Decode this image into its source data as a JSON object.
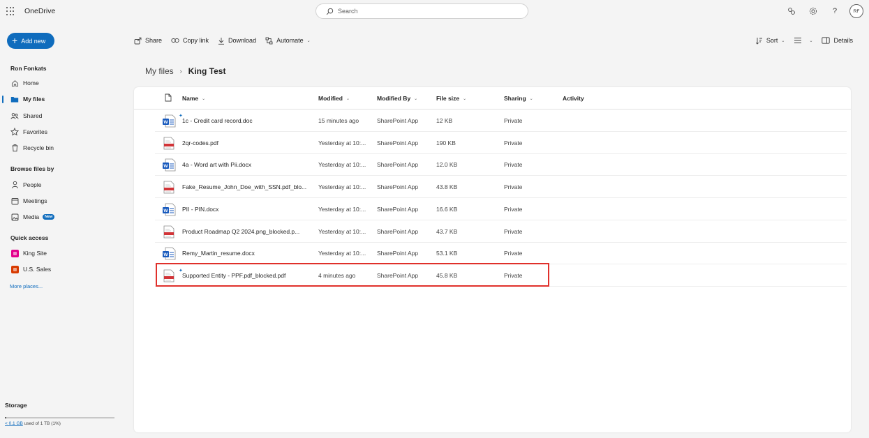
{
  "app": {
    "title": "OneDrive"
  },
  "search": {
    "placeholder": "Search"
  },
  "user": {
    "initials": "RF",
    "name": "Ron Fonkats"
  },
  "sidebar": {
    "add_new": "Add new",
    "items": [
      {
        "label": "Home",
        "icon": "home-icon"
      },
      {
        "label": "My files",
        "icon": "folder-icon",
        "active": true
      },
      {
        "label": "Shared",
        "icon": "people-icon"
      },
      {
        "label": "Favorites",
        "icon": "star-icon"
      },
      {
        "label": "Recycle bin",
        "icon": "trash-icon"
      }
    ],
    "browse_heading": "Browse files by",
    "browse": [
      {
        "label": "People",
        "icon": "person-icon"
      },
      {
        "label": "Meetings",
        "icon": "calendar-icon"
      },
      {
        "label": "Media",
        "icon": "image-icon",
        "badge": "New"
      }
    ],
    "quick_heading": "Quick access",
    "quick": [
      {
        "label": "King Site",
        "color": "#e3008c"
      },
      {
        "label": "U.S. Sales",
        "color": "#d83b01"
      }
    ],
    "more_places": "More places...",
    "storage": {
      "heading": "Storage",
      "used_link": "< 0.1 GB",
      "used_text": " used of 1 TB (1%)",
      "fraction": 0.01
    }
  },
  "commands": {
    "share": "Share",
    "copy_link": "Copy link",
    "download": "Download",
    "automate": "Automate",
    "sort": "Sort",
    "details": "Details"
  },
  "breadcrumb": {
    "parent": "My files",
    "current": "King Test"
  },
  "table": {
    "headers": {
      "name": "Name",
      "modified": "Modified",
      "modified_by": "Modified By",
      "size": "File size",
      "sharing": "Sharing",
      "activity": "Activity"
    },
    "rows": [
      {
        "type": "word",
        "name": "1c - Credit card record.doc",
        "modified": "15 minutes ago",
        "by": "SharePoint App",
        "size": "12 KB",
        "sharing": "Private",
        "new": true
      },
      {
        "type": "pdf",
        "name": "2qr-codes.pdf",
        "modified": "Yesterday at 10:...",
        "by": "SharePoint App",
        "size": "190 KB",
        "sharing": "Private",
        "new": false
      },
      {
        "type": "word",
        "name": "4a - Word art with Pii.docx",
        "modified": "Yesterday at 10:...",
        "by": "SharePoint App",
        "size": "12.0 KB",
        "sharing": "Private",
        "new": false
      },
      {
        "type": "pdf",
        "name": "Fake_Resume_John_Doe_with_SSN.pdf_blo...",
        "modified": "Yesterday at 10:...",
        "by": "SharePoint App",
        "size": "43.8 KB",
        "sharing": "Private",
        "new": false
      },
      {
        "type": "word",
        "name": "PII - PIN.docx",
        "modified": "Yesterday at 10:...",
        "by": "SharePoint App",
        "size": "16.6 KB",
        "sharing": "Private",
        "new": false
      },
      {
        "type": "pdf",
        "name": "Product Roadmap Q2 2024.png_blocked.p...",
        "modified": "Yesterday at 10:...",
        "by": "SharePoint App",
        "size": "43.7 KB",
        "sharing": "Private",
        "new": false
      },
      {
        "type": "word",
        "name": "Remy_Martin_resume.docx",
        "modified": "Yesterday at 10:...",
        "by": "SharePoint App",
        "size": "53.1 KB",
        "sharing": "Private",
        "new": false
      },
      {
        "type": "pdf",
        "name": "Supported Entity - PPF.pdf_blocked.pdf",
        "modified": "4 minutes ago",
        "by": "SharePoint App",
        "size": "45.8 KB",
        "sharing": "Private",
        "new": true,
        "highlighted": true
      }
    ]
  },
  "colors": {
    "accent": "#0f6cbd",
    "highlight": "#e0302b",
    "word": "#185abd",
    "pdf": "#d13438"
  }
}
